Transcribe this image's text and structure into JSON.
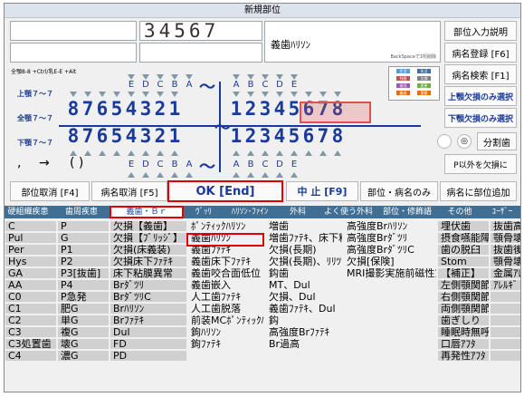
{
  "window": {
    "title": "新規部位"
  },
  "top": {
    "code": "34567",
    "name": "義歯ﾊﾘｿﾝ",
    "hint": "BackSpaceで1桁削除",
    "help": "全顎8-8 +Ctrl/乳E-E +Alt",
    "buttons": {
      "input_help": "部位入力説明",
      "disease_register": "病名登録 [F6]",
      "disease_search": "病名検索 [F1]"
    }
  },
  "rows": {
    "upper_label": "上顎７〜７",
    "full_label": "全顎７〜７",
    "lower_label": "下顎７〜７"
  },
  "teeth": {
    "letters_left": [
      "E",
      "D",
      "C",
      "B",
      "A"
    ],
    "letters_right": [
      "A",
      "B",
      "C",
      "D",
      "E"
    ],
    "digits_left": [
      "8",
      "7",
      "6",
      "5",
      "4",
      "3",
      "2",
      "1"
    ],
    "digits_right": [
      "1",
      "2",
      "3",
      "4",
      "5",
      "6",
      "7",
      "8"
    ],
    "tilde": "〜"
  },
  "side": {
    "upper_missing": "上顎欠損のみ選択",
    "lower_missing": "下顎欠損のみ選択",
    "split": "分割歯",
    "except_p": "P以外を欠損に",
    "radio1": "〇",
    "radio2": "◎"
  },
  "legend": [
    "生活",
    "失活",
    "残根",
    "欠損",
    "歯冠",
    "変更",
    "義歯",
    "要観"
  ],
  "symbols": {
    "comma": ",",
    "arrow": "→",
    "paren": "( )"
  },
  "bottom_buttons": {
    "cancel_site": "部位取消 [F4]",
    "cancel_disease": "病名取消 [F5]",
    "ok": "OK [End]",
    "stop": "中 止 [F9]",
    "site_only": "部位・病名のみ",
    "add_site": "病名に部位追加"
  },
  "tabs": [
    "硬組織疾患",
    "歯周疾患",
    "義歯・Ｂｒ",
    "ｳﾞｯﾘ",
    "ﾊﾘｿﾝ･ﾌｧｲﾝ",
    "外科",
    "よく使う外科",
    "部位・修飾語",
    "その他",
    "ﾕｰｻﾞｰ"
  ],
  "columns": {
    "col1": [
      "C",
      "Pul",
      "Per",
      "Hys",
      "GA",
      "AA",
      "C0",
      "C1",
      "C2",
      "C3",
      "C3処置歯",
      "C4"
    ],
    "col2": [
      "P",
      "G",
      "P1",
      "P2",
      "P3[抜歯]",
      "P4",
      "P急発",
      "肥G",
      "単G",
      "複G",
      "壊G",
      "濃G"
    ],
    "col3": [
      "欠損【義歯】",
      "欠損【ﾌﾞﾘｯｼﾞ】",
      "欠損(床義装)",
      "欠損床下ﾌｧﾃｷ",
      "床下粘膜異常",
      "Brﾀﾞﾂﾘ",
      "BrﾀﾞﾂﾘC",
      "Brﾊﾘｿﾝ",
      "Brﾌｧﾃｷ",
      "Dul",
      "FD",
      "PD"
    ],
    "col4": [
      "ﾎﾟﾝﾃｨｯｸﾊﾘｿﾝ",
      "義歯ﾊﾘｿﾝ",
      "義歯ﾌｧﾃｷ",
      "義歯床下ﾌｧﾃｷ",
      "義歯咬合面低位",
      "義歯嵌入",
      "人工歯ﾌｧﾃｷ",
      "人工歯脱落",
      "前装MCﾎﾟﾝﾃｨｯｸﾊﾘｿﾝ",
      "鉤ﾊﾘｿﾝ",
      "鉤ﾌｧﾃｷ",
      ""
    ],
    "col5": [
      "増歯",
      "増歯ﾌｧﾃｷ、床下粘膜異常",
      "欠損(長期)",
      "欠損(長期)、ﾘﾘﾂ",
      "鈎歯",
      "MT、Dul",
      "欠損、Dul",
      "義歯ﾌｧﾃｷ、Dul",
      "鈎",
      "高強度Brﾌｧﾃｷ",
      "Br過高",
      ""
    ],
    "col6": [
      "高強度Brﾊﾘｿﾝ",
      "高強度Brﾀﾞﾂﾘ",
      "高強度BrﾀﾞﾂﾘC",
      "欠損[保険]",
      "MRI撮影実施前磁性ｱﾀｯﾁ",
      "",
      "",
      "",
      "",
      "",
      "",
      ""
    ],
    "col7": [
      "埋伏歯",
      "摂食嚥能障害",
      "歯の脱臼",
      "Stom",
      "【補正】",
      "左側顎関節症",
      "右側顎関節症",
      "両側顎関節症",
      "歯ぎしり",
      "睡眠時無呼吸",
      "口唇ｱﾌﾀ",
      "再発性ｱﾌﾀ"
    ],
    "col8": [
      "抜歯高",
      "顎骨壊",
      "抜歯後",
      "顎骨壊",
      "金属ｱﾚ",
      "ｱﾚﾙｷﾞ",
      "",
      "",
      "",
      "",
      "",
      ""
    ]
  },
  "colors": {
    "accent": "#1a3a9a",
    "tab_bar": "#3f6f94",
    "ok_outline": "#e00000",
    "highlight": "#e05050"
  }
}
